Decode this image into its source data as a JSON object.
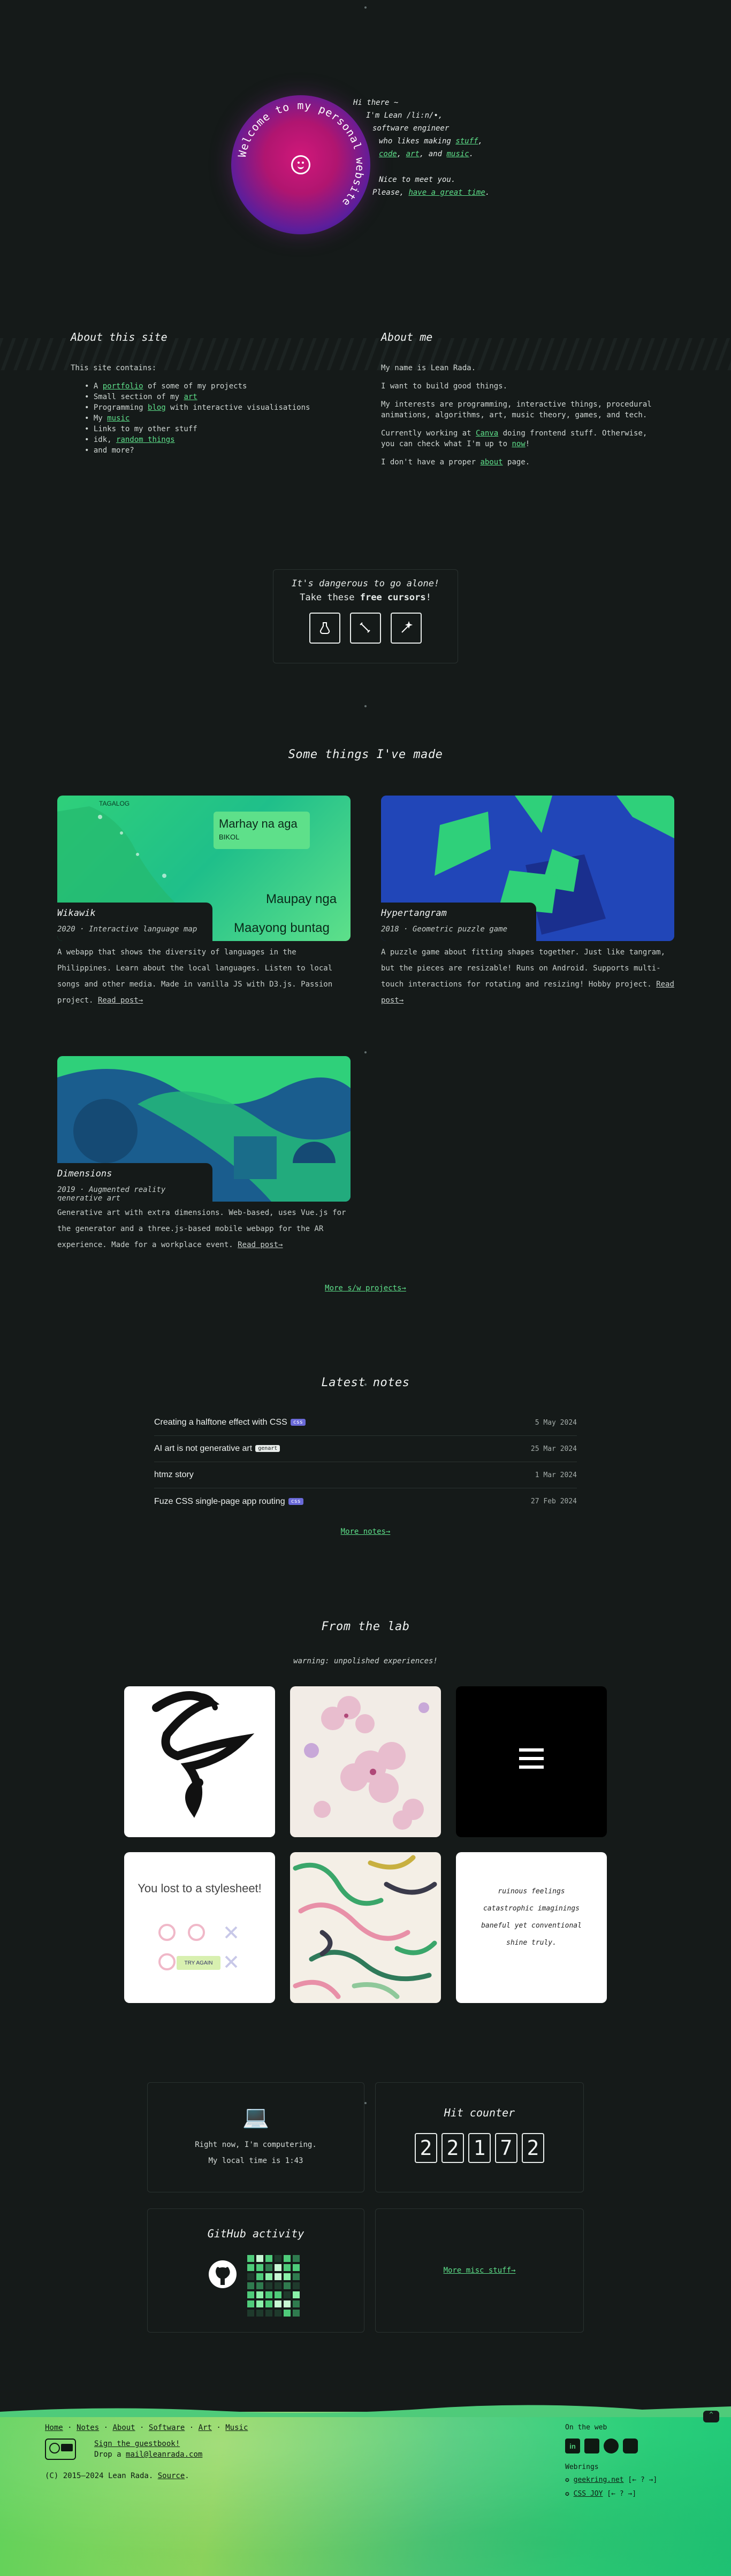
{
  "hero": {
    "ring_text": "Welcome to my personal website",
    "lines": [
      "Hi there ~",
      "I'm Lean /li:n/•,",
      "software engineer",
      "who likes making",
      "stuff",
      ",",
      "code",
      ",",
      "art",
      ", and",
      "music",
      ".",
      "Nice to meet you.",
      "Please,",
      "have a great time",
      "."
    ]
  },
  "about_site": {
    "title": "About this site",
    "intro": "This site contains:",
    "items": [
      {
        "pre": "A ",
        "link": "portfolio",
        "post": " of some of my projects"
      },
      {
        "pre": "Small section of my ",
        "link": "art",
        "post": ""
      },
      {
        "pre": "Programming ",
        "link": "blog",
        "post": " with interactive visualisations"
      },
      {
        "pre": "My ",
        "link": "music",
        "post": ""
      },
      {
        "pre": "Links to my other stuff",
        "link": "",
        "post": ""
      },
      {
        "pre": "idk, ",
        "link": "random things",
        "post": ""
      },
      {
        "pre": "and more?",
        "link": "",
        "post": ""
      }
    ]
  },
  "about_me": {
    "title": "About me",
    "p1": "My name is Lean Rada.",
    "p2": "I want to build good things.",
    "p3": "My interests are programming, interactive things, procedural animations, algorithms, art, music theory, games, and tech.",
    "p4_pre": "Currently working at ",
    "p4_link1": "Canva",
    "p4_mid": " doing frontend stuff. Otherwise, you can check what I'm up to ",
    "p4_link2": "now",
    "p4_post": "!",
    "p5_pre": "I don't have a proper ",
    "p5_link": "about",
    "p5_post": " page."
  },
  "cursors": {
    "line1": "It's dangerous to go alone!",
    "line2_pre": "Take these ",
    "line2_bold": "free cursors",
    "line2_post": "!",
    "icons": [
      "potion-cursor-icon",
      "sword-cursor-icon",
      "wand-cursor-icon"
    ]
  },
  "projects": {
    "title": "Some things I've made",
    "items": [
      {
        "name": "Wikawik",
        "sub": "2020 · Interactive language map",
        "desc": "A webapp that shows the diversity of languages in the Philippines. Learn about the local languages. Listen to local songs and other media. Made in vanilla JS with D3.js. Passion project.",
        "link": "Read post→",
        "map_labels": [
          "TAGALOG",
          "Marhay na aga",
          "BIKOL",
          "Maupay nga",
          "Maayong buntag"
        ]
      },
      {
        "name": "Hypertangram",
        "sub": "2018 · Geometric puzzle game",
        "desc": "A puzzle game about fitting shapes together. Just like tangram, but the pieces are resizable! Runs on Android. Supports multi-touch interactions for rotating and resizing! Hobby project.",
        "link": "Read post→"
      },
      {
        "name": "Dimensions",
        "sub": "2019 · Augmented reality generative art",
        "desc": "Generative art with extra dimensions. Web-based, uses Vue.js for the generator and a three.js-based mobile webapp for the AR experience. Made for a workplace event.",
        "link": "Read post→"
      }
    ],
    "more": "More s/w projects→"
  },
  "notes": {
    "title": "Latest notes",
    "items": [
      {
        "title": "Creating a halftone effect with CSS",
        "tag": "css",
        "date": "5 May 2024"
      },
      {
        "title": "AI art is not generative art",
        "tag": "genart",
        "date": "25 Mar 2024"
      },
      {
        "title": "htmz story",
        "tag": "",
        "date": "1 Mar 2024"
      },
      {
        "title": "Fuze CSS single-page app routing",
        "tag": "css",
        "date": "27 Feb 2024"
      }
    ],
    "more": "More notes→"
  },
  "lab": {
    "title": "From the lab",
    "warning": "warning: unpolished experiences!",
    "game_text": "You lost to a stylesheet!",
    "try_again": "TRY AGAIN",
    "poem": [
      "ruinous feelings",
      "catastrophic imaginings",
      "baneful yet conventional",
      "shine truly."
    ]
  },
  "status": {
    "line1": "Right now, I'm computering.",
    "line2": "My local time is 1:43"
  },
  "hits": {
    "title": "Hit counter",
    "digits": [
      "2",
      "2",
      "1",
      "7",
      "2"
    ]
  },
  "github": {
    "title": "GitHub activity"
  },
  "misc": {
    "link": "More misc stuff→"
  },
  "footer": {
    "nav": [
      "Home",
      "Notes",
      "About",
      "Software",
      "Art",
      "Music"
    ],
    "guestbook": "Sign the guestbook!",
    "mail_pre": "Drop a ",
    "mail_link": "mail@leanrada.com",
    "copyright_pre": "(C) 2015–2024 Lean Rada. ",
    "source": "Source",
    "copyright_post": ".",
    "on_web": "On the web",
    "webrings": "Webrings",
    "rings": [
      {
        "name": "geekring.net",
        "nav": "[← ? →]"
      },
      {
        "name": "CSS JOY",
        "nav": "[← ? →]"
      }
    ]
  },
  "colors": {
    "background": "#151a19",
    "accent": "#5ee08a",
    "orb": "#c0167a",
    "footer_green": "#4fcb7a"
  }
}
